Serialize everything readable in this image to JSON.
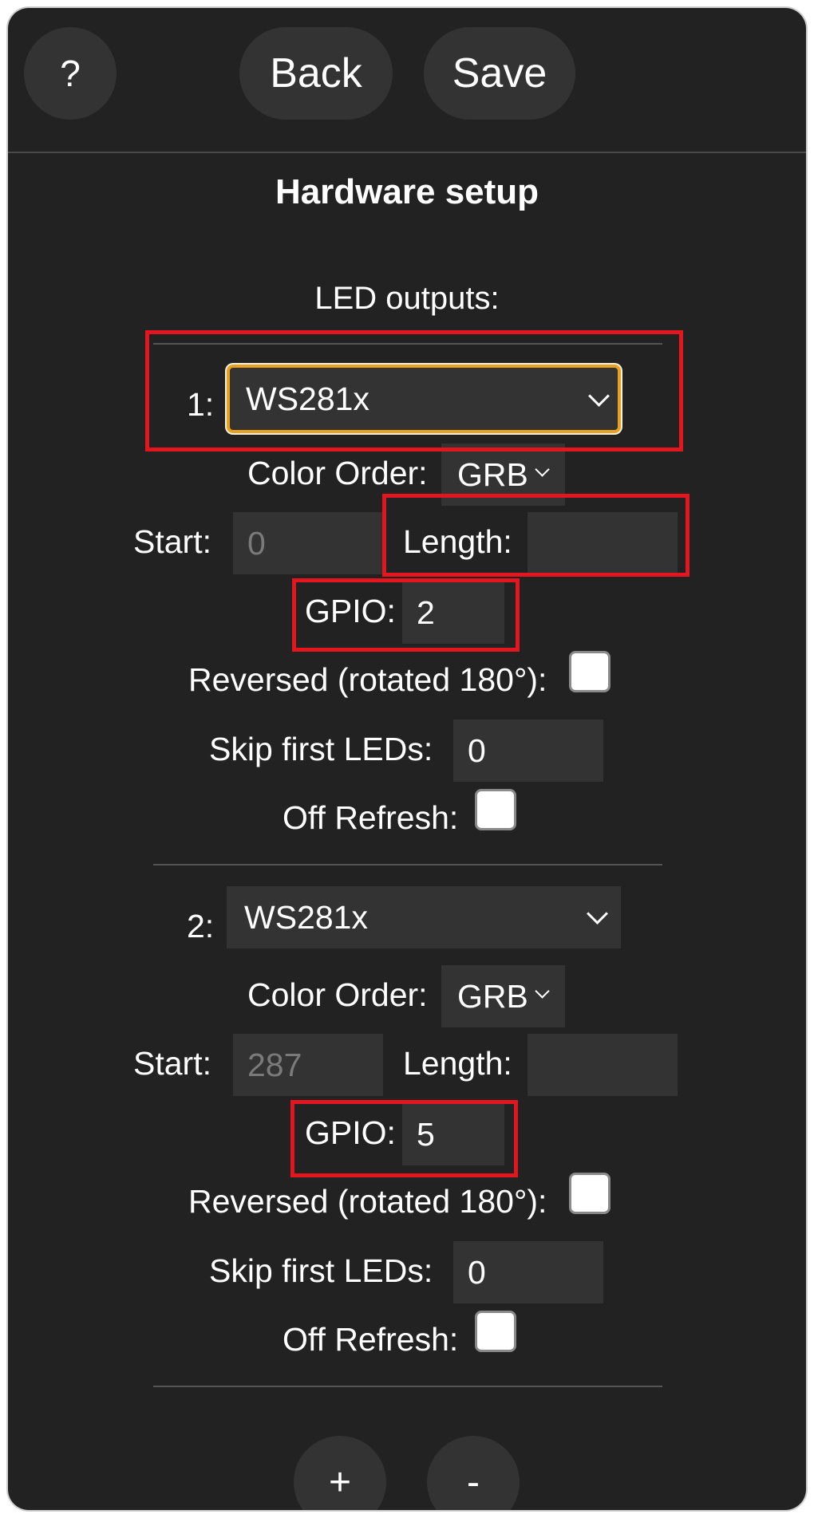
{
  "topbar": {
    "help_label": "?",
    "back_label": "Back",
    "save_label": "Save"
  },
  "page": {
    "title": "Hardware setup",
    "section_label": "LED outputs:"
  },
  "outputs": [
    {
      "index": "1:",
      "type": "WS281x",
      "color_order_label": "Color Order:",
      "color_order": "GRB",
      "start_label": "Start:",
      "start_value": "0",
      "length_label": "Length:",
      "length_value": "",
      "gpio_label": "GPIO:",
      "gpio_value": "2",
      "reversed_label": "Reversed (rotated 180°):",
      "reversed_checked": false,
      "skip_label": "Skip first LEDs:",
      "skip_value": "0",
      "off_refresh_label": "Off Refresh:",
      "off_refresh_checked": false
    },
    {
      "index": "2:",
      "type": "WS281x",
      "color_order_label": "Color Order:",
      "color_order": "GRB",
      "start_label": "Start:",
      "start_value": "287",
      "length_label": "Length:",
      "length_value": "",
      "gpio_label": "GPIO:",
      "gpio_value": "5",
      "reversed_label": "Reversed (rotated 180°):",
      "reversed_checked": false,
      "skip_label": "Skip first LEDs:",
      "skip_value": "0",
      "off_refresh_label": "Off Refresh:",
      "off_refresh_checked": false
    }
  ],
  "footer": {
    "add_label": "+",
    "remove_label": "-"
  },
  "colors": {
    "background": "#222222",
    "control": "#333333",
    "focus": "#e9a21f",
    "highlight": "#e3151f"
  }
}
